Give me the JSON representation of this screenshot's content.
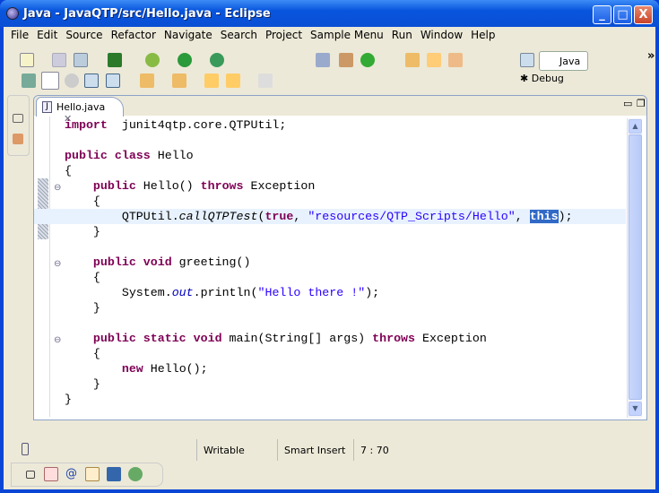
{
  "window": {
    "title": "Java - JavaQTP/src/Hello.java - Eclipse",
    "minimize": "_",
    "maximize": "□",
    "close": "X"
  },
  "menu": [
    "File",
    "Edit",
    "Source",
    "Refactor",
    "Navigate",
    "Search",
    "Project",
    "Sample Menu",
    "Run",
    "Window",
    "Help"
  ],
  "perspectives": {
    "java": "Java",
    "debug": "Debug",
    "more": "»"
  },
  "editor": {
    "tab_label": "Hello.java",
    "tab_close": "✕",
    "lines": [
      [
        [
          "kw",
          "import"
        ],
        [
          "",
          "  junit4qtp.core.QTPUtil;"
        ]
      ],
      [],
      [
        [
          "kw",
          "public class"
        ],
        [
          "",
          " Hello"
        ]
      ],
      [
        [
          "",
          "{"
        ]
      ],
      [
        [
          "",
          "    "
        ],
        [
          "kw",
          "public"
        ],
        [
          "",
          " Hello() "
        ],
        [
          "kw",
          "throws"
        ],
        [
          "",
          " Exception"
        ]
      ],
      [
        [
          "",
          "    {"
        ]
      ],
      [
        [
          "",
          "        QTPUtil."
        ],
        [
          "it",
          "callQTPTest"
        ],
        [
          "",
          "("
        ],
        [
          "kw",
          "true"
        ],
        [
          "",
          ", "
        ],
        [
          "str",
          "\"resources/QTP_Scripts/Hello\""
        ],
        [
          "",
          ", "
        ],
        [
          "sel",
          "this"
        ],
        [
          "",
          ");"
        ]
      ],
      [
        [
          "",
          "    }"
        ]
      ],
      [],
      [
        [
          "",
          "    "
        ],
        [
          "kw",
          "public void"
        ],
        [
          "",
          " greeting()"
        ]
      ],
      [
        [
          "",
          "    {"
        ]
      ],
      [
        [
          "",
          "        System."
        ],
        [
          "itb",
          "out"
        ],
        [
          "",
          ".println("
        ],
        [
          "str",
          "\"Hello there !\""
        ],
        [
          "",
          ");"
        ]
      ],
      [
        [
          "",
          "    }"
        ]
      ],
      [],
      [
        [
          "",
          "    "
        ],
        [
          "kw",
          "public static void"
        ],
        [
          "",
          " main(String[] args) "
        ],
        [
          "kw",
          "throws"
        ],
        [
          "",
          " Exception"
        ]
      ],
      [
        [
          "",
          "    {"
        ]
      ],
      [
        [
          "",
          "        "
        ],
        [
          "kw",
          "new"
        ],
        [
          "",
          " Hello();"
        ]
      ],
      [
        [
          "",
          "    }"
        ]
      ],
      [
        [
          "",
          "}"
        ]
      ]
    ],
    "current_line": 7
  },
  "status": {
    "writable": "Writable",
    "insert_mode": "Smart Insert",
    "position": "7 : 70"
  }
}
